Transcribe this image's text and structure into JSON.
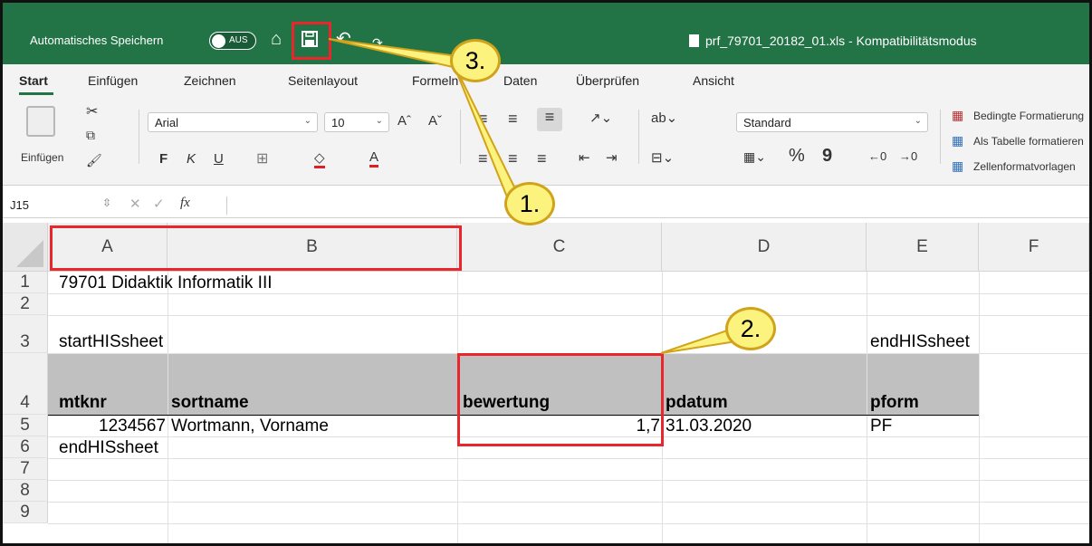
{
  "titlebar": {
    "autosave_label": "Automatisches Speichern",
    "toggle_label": "AUS",
    "doc_title": "prf_79701_20182_01.xls  -  Kompatibilitätsmodus"
  },
  "tabs": [
    "Start",
    "Einfügen",
    "Zeichnen",
    "Seitenlayout",
    "Formeln",
    "Daten",
    "Überprüfen",
    "Ansicht"
  ],
  "ribbon": {
    "paste_label": "Einfügen",
    "font_name": "Arial",
    "font_size": "10",
    "bold": "F",
    "italic": "K",
    "underline": "U",
    "number_format": "Standard",
    "percent": "%",
    "comma": "9",
    "cond_format": "Bedingte Formatierung",
    "as_table": "Als Tabelle formatieren",
    "cell_styles": "Zellenformatvorlagen"
  },
  "formula_bar": {
    "name_box": "J15",
    "fx": "fx"
  },
  "columns": [
    "A",
    "B",
    "C",
    "D",
    "E",
    "F"
  ],
  "rows": [
    "1",
    "2",
    "3",
    "4",
    "5",
    "6",
    "7",
    "8",
    "9"
  ],
  "cells": {
    "r1": "79701  Didaktik Informatik III",
    "r3a": "startHISsheet",
    "r3e": "endHISsheet",
    "r4a": "mtknr",
    "r4b": "sortname",
    "r4c": "bewertung",
    "r4d": "pdatum",
    "r4e": "pform",
    "r5a": "1234567",
    "r5b": "Wortmann, Vorname",
    "r5c": "1,7",
    "r5d": "31.03.2020",
    "r5e": "PF",
    "r6a": "endHISsheet"
  },
  "callouts": {
    "one": "1.",
    "two": "2.",
    "three": "3."
  },
  "colors": {
    "excel_green": "#227447",
    "highlight_red": "#e8262b",
    "callout_yellow": "#fcf27e"
  }
}
